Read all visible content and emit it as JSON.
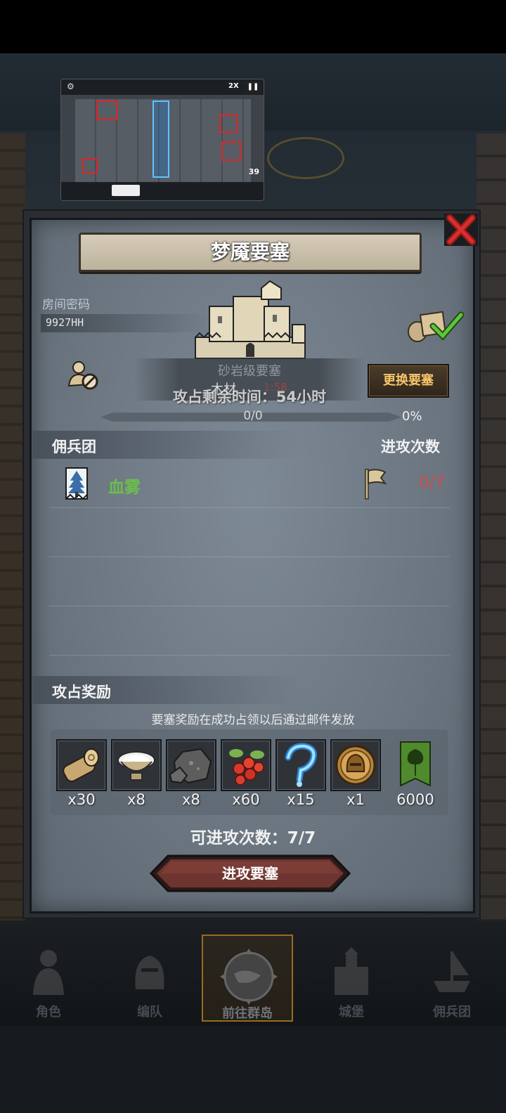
{
  "modal": {
    "title": "梦魇要塞",
    "room_code_label": "房间密码",
    "room_code_value": "9927HH",
    "fort_type": "砂岩级要塞",
    "wood_label": "木材",
    "wood_value": "1:58",
    "remaining_time": "攻占剩余时间：54小时",
    "change_button": "更换要塞",
    "progress_text": "0/0",
    "progress_percent_text": "0%",
    "progress_fraction": 0,
    "mercenary_header": "佣兵团",
    "attack_count_header": "进攻次数",
    "guilds": [
      {
        "name": "血雾",
        "count": "0/7",
        "icon": "tree-banner-icon"
      }
    ],
    "rewards_header": "攻占奖励",
    "rewards_note": "要塞奖励在成功占领以后通过邮件发放",
    "rewards": [
      {
        "icon": "log-icon",
        "qty": "x30"
      },
      {
        "icon": "milk-bowl-icon",
        "qty": "x8"
      },
      {
        "icon": "coal-ore-icon",
        "qty": "x8"
      },
      {
        "icon": "berries-icon",
        "qty": "x60"
      },
      {
        "icon": "blue-hook-icon",
        "qty": "x15"
      },
      {
        "icon": "helmet-coin-icon",
        "qty": "x1"
      },
      {
        "icon": "guild-banner-icon",
        "qty": "6000"
      }
    ],
    "available_attacks": "可进攻次数：7/7",
    "attack_button": "进攻要塞"
  },
  "thumbnail": {
    "speed": "2X",
    "count": "39"
  },
  "bottom_nav": [
    {
      "label": "角色",
      "icon": "knight-icon"
    },
    {
      "label": "编队",
      "icon": "helmet-icon"
    },
    {
      "label": "前往群岛",
      "icon": "compass-icon",
      "active": true
    },
    {
      "label": "城堡",
      "icon": "castle-icon"
    },
    {
      "label": "佣兵团",
      "icon": "ship-icon"
    }
  ],
  "colors": {
    "guild_name": "#6bbe4e",
    "guild_count": "#cf4b4b",
    "change_button_text": "#f7c56a",
    "active_nav_border": "#9a6c1c"
  }
}
